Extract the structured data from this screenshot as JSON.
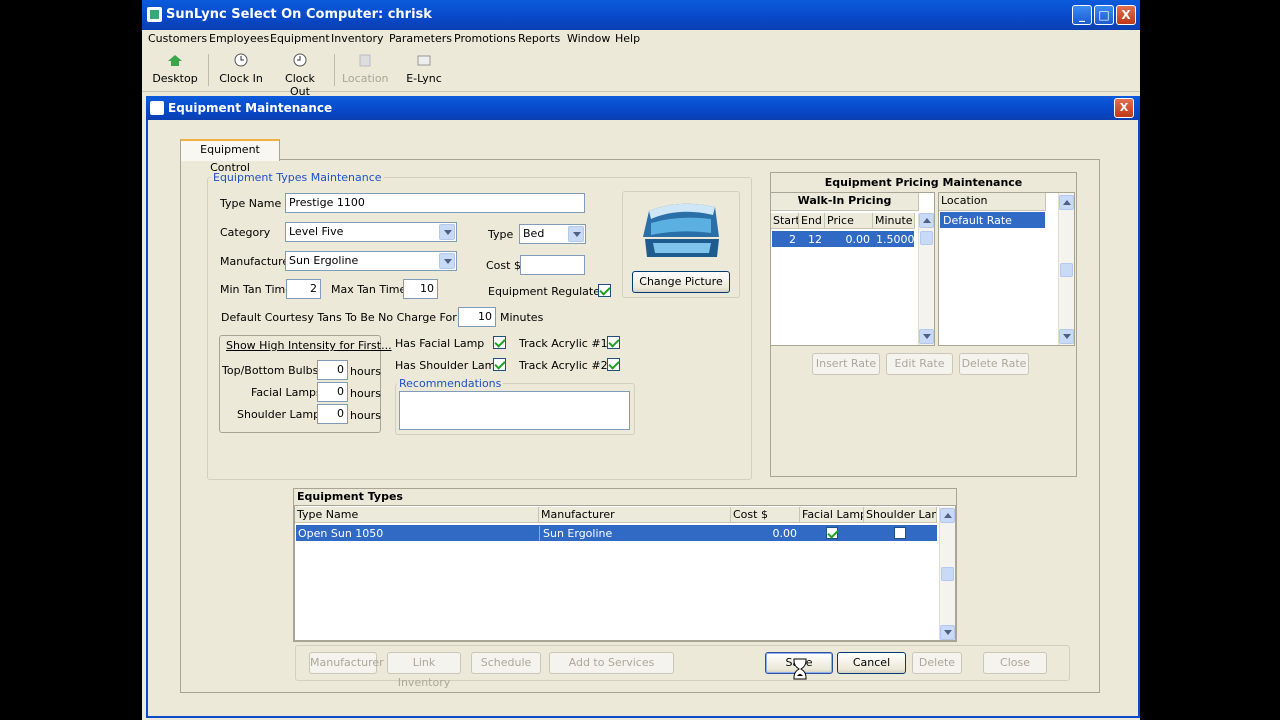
{
  "app": {
    "title": "SunLync Select On Computer: chrisk",
    "menu": [
      "Customers",
      "Employees",
      "Equipment",
      "Inventory",
      "Parameters",
      "Promotions",
      "Reports",
      "Window",
      "Help"
    ],
    "toolbar": {
      "desktop": "Desktop",
      "clock_in": "Clock In",
      "clock_out": "Clock Out",
      "location": "Location",
      "elync": "E-Lync"
    },
    "window_buttons": {
      "minimize": "_",
      "maximize": "□",
      "close": "X"
    }
  },
  "dialog": {
    "title": "Equipment Maintenance",
    "close": "X",
    "tab_label": "Equipment Control"
  },
  "types_maint": {
    "group_label": "Equipment Types Maintenance",
    "type_name_label": "Type Name",
    "type_name_value": "Prestige 1100",
    "category_label": "Category",
    "category_value": "Level Five",
    "type_label": "Type",
    "type_value": "Bed",
    "manufacturer_label": "Manufacturer",
    "manufacturer_value": "Sun Ergoline",
    "cost_label": "Cost $",
    "cost_value": "",
    "min_tan_label": "Min Tan Time",
    "min_tan_value": "2",
    "max_tan_label": "Max Tan Time",
    "max_tan_value": "10",
    "regulated_label": "Equipment Regulated",
    "regulated": true,
    "courtesy_label": "Default Courtesy Tans To Be No Charge For Up To",
    "courtesy_value": "10",
    "courtesy_unit": "Minutes",
    "change_picture": "Change Picture"
  },
  "intensity": {
    "button": "Show High Intensity for First...",
    "top_bottom_label": "Top/Bottom Bulbs:",
    "top_bottom_value": "0",
    "facial_label": "Facial Lamps:",
    "facial_value": "0",
    "shoulder_label": "Shoulder Lamps:",
    "shoulder_value": "0",
    "unit": "hours"
  },
  "features": {
    "has_facial_label": "Has Facial Lamp",
    "has_facial": true,
    "has_shoulder_label": "Has Shoulder Lamp",
    "has_shoulder": true,
    "track1_label": "Track Acrylic #1",
    "track1": true,
    "track2_label": "Track Acrylic #2",
    "track2": true,
    "recommendations_label": "Recommendations",
    "recommendations_value": ""
  },
  "pricing": {
    "title": "Equipment Pricing Maintenance",
    "walkin_title": "Walk-In Pricing",
    "columns": [
      "Start",
      "End",
      "Price",
      "Minute"
    ],
    "rows": [
      [
        "2",
        "12",
        "0.00",
        "1.5000"
      ]
    ],
    "location_header": "Location",
    "locations": [
      "Default Rate"
    ],
    "insert": "Insert Rate",
    "edit": "Edit Rate",
    "delete": "Delete Rate"
  },
  "types_table": {
    "title": "Equipment Types",
    "columns": [
      "Type Name",
      "Manufacturer",
      "Cost $",
      "Facial Lamp",
      "Shoulder Lamp"
    ],
    "rows": [
      {
        "type_name": "Open Sun 1050",
        "manufacturer": "Sun Ergoline",
        "cost": "0.00",
        "facial": true,
        "shoulder": false
      }
    ]
  },
  "footer_buttons": {
    "manufacturer": "Manufacturer",
    "link_inventory": "Link Inventory",
    "schedule": "Schedule",
    "add_to_services": "Add to Services",
    "save": "Save",
    "cancel": "Cancel",
    "delete": "Delete",
    "close": "Close"
  },
  "colors": {
    "titlebar": "#0a5bdc",
    "selection": "#316ac5",
    "groupbox_label": "#1e50c8",
    "face": "#ece9d8"
  }
}
